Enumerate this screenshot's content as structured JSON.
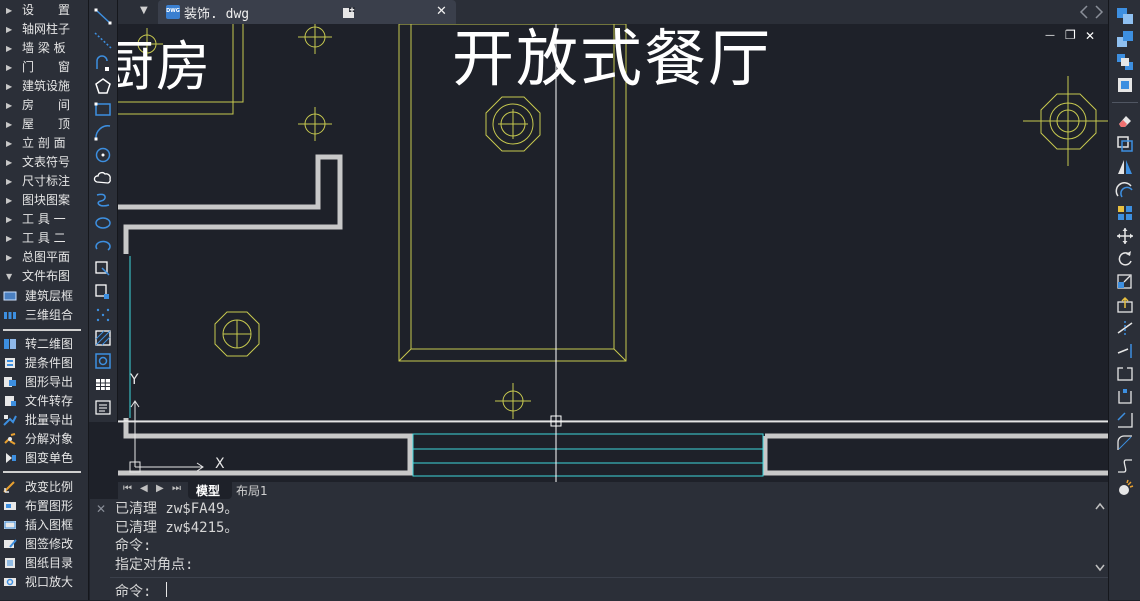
{
  "left_menu": {
    "items": [
      {
        "label": "设　　置",
        "arrow": "▶"
      },
      {
        "label": "轴网柱子",
        "arrow": "▶"
      },
      {
        "label": "墙 梁 板",
        "arrow": "▶"
      },
      {
        "label": "门　　窗",
        "arrow": "▶"
      },
      {
        "label": "建筑设施",
        "arrow": "▶"
      },
      {
        "label": "房　　间",
        "arrow": "▶"
      },
      {
        "label": "屋　　顶",
        "arrow": "▶"
      },
      {
        "label": "立 剖 面",
        "arrow": "▶"
      },
      {
        "label": "文表符号",
        "arrow": "▶"
      },
      {
        "label": "尺寸标注",
        "arrow": "▶"
      },
      {
        "label": "图块图案",
        "arrow": "▶"
      },
      {
        "label": "工 具 一",
        "arrow": "▶"
      },
      {
        "label": "工 具 二",
        "arrow": "▶"
      },
      {
        "label": "总图平面",
        "arrow": "▶"
      },
      {
        "label": "文件布图",
        "arrow": "▼"
      }
    ],
    "sub_items_a": [
      "建筑层框",
      "三维组合"
    ],
    "sub_items_b": [
      "转二维图",
      "提条件图",
      "图形导出",
      "文件转存",
      "批量导出",
      "分解对象",
      "图变单色"
    ],
    "sub_items_c": [
      "改变比例",
      "布置图形",
      "插入图框",
      "图签修改",
      "图纸目录",
      "视口放大"
    ]
  },
  "tab": {
    "file_name": "装饰. dwg",
    "badge": "DWG",
    "menu_arrow": "▼",
    "close": "✕"
  },
  "canvas": {
    "labels": {
      "kitchen": "厨房",
      "dining": "开放式餐厅",
      "axis_x": "X",
      "axis_y": "Y"
    },
    "window_controls": {
      "min": "—",
      "restore": "❐",
      "close": "✕"
    }
  },
  "layout_tabs": {
    "model": "模型",
    "layout1": "布局1",
    "nav": [
      "⏮",
      "◀",
      "▶",
      "⏭"
    ]
  },
  "command": {
    "lines": [
      "已清理 zw$FA49。",
      "已清理 zw$4215。",
      "命令:",
      "指定对角点:"
    ],
    "prompt": "命令: ",
    "close": "✕"
  },
  "colors": {
    "panel": "#2b2f38",
    "canvas": "#1e2129",
    "wall": "#c8c8c8",
    "furniture": "#c7c94f",
    "cyan": "#3ed6dc",
    "accent": "#3d8fe0"
  }
}
